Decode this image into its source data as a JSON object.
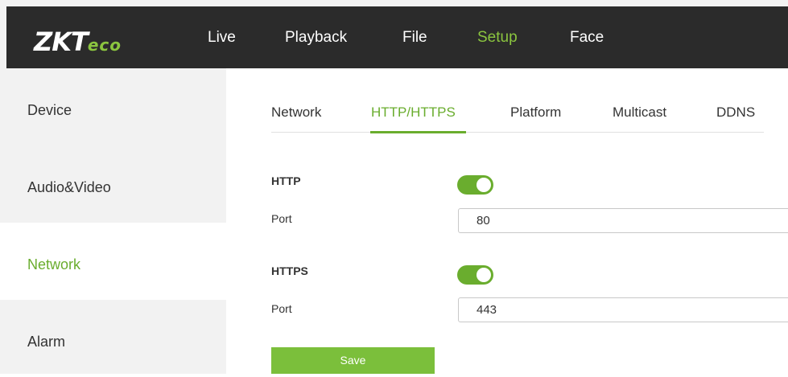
{
  "header": {
    "logo": {
      "main": "ZKT",
      "suffix": "eco"
    },
    "nav": [
      {
        "label": "Live"
      },
      {
        "label": "Playback"
      },
      {
        "label": "File"
      },
      {
        "label": "Setup",
        "active": true
      },
      {
        "label": "Face"
      }
    ]
  },
  "sidebar": {
    "items": [
      {
        "label": "Device"
      },
      {
        "label": "Audio&Video"
      },
      {
        "label": "Network",
        "active": true
      },
      {
        "label": "Alarm"
      }
    ]
  },
  "tabs": [
    {
      "label": "Network"
    },
    {
      "label": "HTTP/HTTPS",
      "active": true
    },
    {
      "label": "Platform"
    },
    {
      "label": "Multicast"
    },
    {
      "label": "DDNS"
    }
  ],
  "form": {
    "http": {
      "label": "HTTP",
      "enabled": true,
      "port_label": "Port",
      "port_value": "80"
    },
    "https": {
      "label": "HTTPS",
      "enabled": true,
      "port_label": "Port",
      "port_value": "443"
    },
    "save_label": "Save"
  },
  "colors": {
    "accent": "#6aad2e",
    "header_bg": "#2b2b2b",
    "sidebar_bg": "#f2f2f2"
  }
}
